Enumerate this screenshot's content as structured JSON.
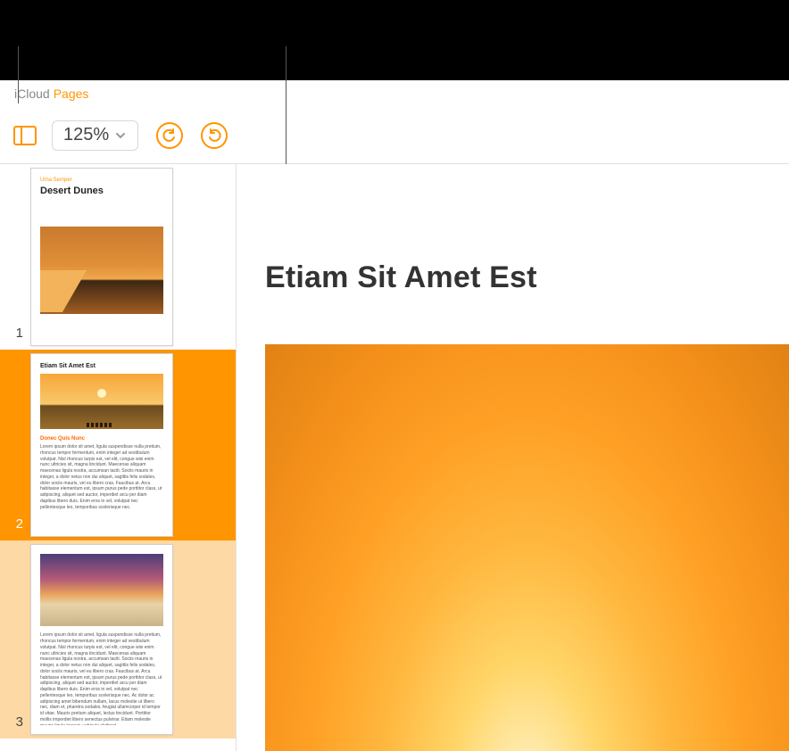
{
  "header": {
    "icloud_label": "iCloud",
    "pages_label": "Pages"
  },
  "toolbar": {
    "zoom_value": "125%"
  },
  "sidebar": {
    "pages": [
      {
        "num": "1",
        "tiny_label": "Urna Semper",
        "title": "Desert Dunes"
      },
      {
        "num": "2",
        "heading_small": "Etiam Sit Amet Est",
        "subhead": "Donec Quis Nunc",
        "body": "Lorem ipsum dolor sit amet, ligula suspendisse nulla pretium, rhoncus tempor fermentum, enim integer ad vestibulum volutpat. Nisl rhoncus turpis est, vel elit, congue wisi enim nunc ultricies sit, magna tincidunt. Maecenas aliquam maecenas ligula nostra, accumsan taciti. Sociis mauris in integer, a dolor netus non dui aliquet, sagittis felis sodales, dolor sociis mauris, vel eu libero cras. Faucibus at. Arcu habitasse elementum est, ipsum purus pede porttitor class, ut adipiscing, aliquet sed auctor, imperdiet arcu per diam dapibus libero duis. Enim eros in vel, volutpat nec pellentesque leo, temporibus scelerisque nec."
      },
      {
        "num": "3",
        "body": "Lorem ipsum dolor sit amet, ligula suspendisse nulla pretium, rhoncus tempor fermentum, enim integer ad vestibulum volutpat. Nisl rhoncus turpis est, vel elit, congue wisi enim nunc ultricies sit, magna tincidunt. Maecenas aliquam maecenas ligula nostra, accumsan taciti. Sociis mauris in integer, a dolor netus non dui aliquet, sagittis felis sodales, dolor sociis mauris, vel eu libero cras. Faucibus at. Arcu habitasse elementum est, ipsum purus pede porttitor class, ut adipiscing, aliquet sed auctor, imperdiet arcu per diam dapibus libero duis. Enim eros in vel, volutpat nec pellentesque leo, temporibus scelerisque nec. Ac dolor ac adipiscing amet bibendum nullam, lacus molestie ut libero nec, diam et, pharetra sodales, feugiat ullamcorper id tempor id vitae. Mauris pretium aliquet, lectus tincidunt. Porttitor mollis imperdiet libero senectus pulvinar. Etiam molestie mauris ligula laoreet, vehicula eleifend."
      }
    ]
  },
  "document": {
    "heading": "Etiam Sit Amet Est"
  }
}
